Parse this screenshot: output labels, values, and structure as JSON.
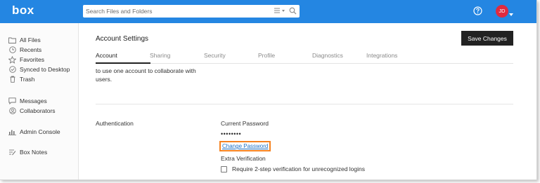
{
  "header": {
    "logo": "box",
    "search_placeholder": "Search Files and Folders",
    "avatar_initials": "JD",
    "brand_color": "#2486e2"
  },
  "sidebar": {
    "items": [
      {
        "label": "All Files",
        "icon": "folder-icon"
      },
      {
        "label": "Recents",
        "icon": "clock-icon"
      },
      {
        "label": "Favorites",
        "icon": "star-icon"
      },
      {
        "label": "Synced to Desktop",
        "icon": "check-circle-icon"
      },
      {
        "label": "Trash",
        "icon": "trash-icon"
      },
      {
        "label": "Messages",
        "icon": "message-icon"
      },
      {
        "label": "Collaborators",
        "icon": "collaborators-icon"
      },
      {
        "label": "Admin Console",
        "icon": "bar-chart-icon"
      },
      {
        "label": "Box Notes",
        "icon": "notes-icon"
      }
    ]
  },
  "main": {
    "title": "Account Settings",
    "save_label": "Save Changes",
    "tabs": [
      {
        "label": "Account",
        "active": true
      },
      {
        "label": "Sharing",
        "active": false
      },
      {
        "label": "Security",
        "active": false
      },
      {
        "label": "Profile",
        "active": false
      },
      {
        "label": "Diagnostics",
        "active": false
      },
      {
        "label": "Integrations",
        "active": false
      }
    ],
    "description": "to use one account to collaborate with users.",
    "auth": {
      "section_label": "Authentication",
      "current_password_label": "Current Password",
      "password_value": "••••••••",
      "change_password_link": "Change Password",
      "highlight_color": "#f58220",
      "extra_verification_label": "Extra Verification",
      "two_step_label": "Require 2-step verification for unrecognized logins",
      "two_step_checked": false
    }
  }
}
